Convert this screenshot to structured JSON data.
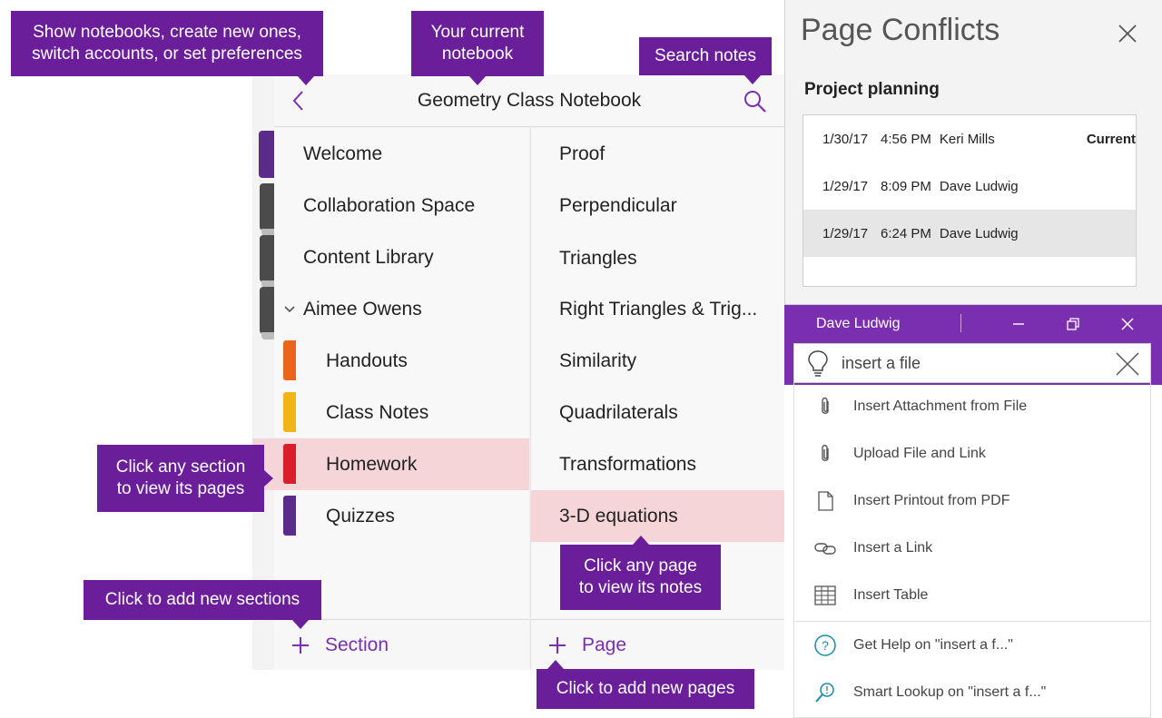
{
  "callouts": {
    "notebooks": "Show notebooks, create new ones,\nswitch accounts, or set preferences",
    "current_notebook": "Your current\nnotebook",
    "search": "Search notes",
    "section": "Click any section\nto view its pages",
    "add_sections": "Click to add new sections",
    "page": "Click any page\nto view its notes",
    "add_pages": "Click to add new pages"
  },
  "header": {
    "title": "Geometry Class Notebook",
    "back_icon": "chevron-left-icon",
    "search_icon": "search-icon"
  },
  "sections": [
    {
      "label": "Welcome",
      "level": 0
    },
    {
      "label": "Collaboration Space",
      "level": 0
    },
    {
      "label": "Content Library",
      "level": 0
    },
    {
      "label": "Aimee Owens",
      "level": 0,
      "expanded": true
    },
    {
      "label": "Handouts",
      "level": 1,
      "color": "#e8651a"
    },
    {
      "label": "Class Notes",
      "level": 1,
      "color": "#f2b418"
    },
    {
      "label": "Homework",
      "level": 1,
      "color": "#d91e2a",
      "selected": true
    },
    {
      "label": "Quizzes",
      "level": 1,
      "color": "#5b2b8c"
    }
  ],
  "pages": [
    {
      "label": "Proof"
    },
    {
      "label": "Perpendicular"
    },
    {
      "label": "Triangles"
    },
    {
      "label": "Right Triangles & Trig..."
    },
    {
      "label": "Similarity"
    },
    {
      "label": "Quadrilaterals"
    },
    {
      "label": "Transformations"
    },
    {
      "label": "3-D equations",
      "selected": true
    }
  ],
  "footer": {
    "add_section": "Section",
    "add_page": "Page"
  },
  "colors": {
    "accent": "#7a2fb0",
    "callout": "#6a1e9a",
    "selected_row": "#f6d5d9",
    "conflict_selected": "#e6e6e6"
  },
  "conflicts": {
    "title": "Page Conflicts",
    "page_name": "Project planning",
    "versions": [
      {
        "date": "1/30/17",
        "time": "4:56 PM",
        "author": "Keri Mills",
        "badge": "Current"
      },
      {
        "date": "1/29/17",
        "time": "8:09 PM",
        "author": "Dave Ludwig"
      },
      {
        "date": "1/29/17",
        "time": "6:24 PM",
        "author": "Dave Ludwig",
        "selected": true
      }
    ]
  },
  "insert_panel": {
    "user": "Dave Ludwig",
    "search_value": "insert a file",
    "items": [
      {
        "label": "Insert Attachment from File",
        "icon": "paperclip-icon"
      },
      {
        "label": "Upload File and Link",
        "icon": "paperclip-icon"
      },
      {
        "label": "Insert Printout from PDF",
        "icon": "document-icon"
      },
      {
        "label": "Insert a Link",
        "icon": "link-icon"
      },
      {
        "label": "Insert Table",
        "icon": "table-icon"
      }
    ],
    "help_items": [
      {
        "label": "Get Help on \"insert a f...\"",
        "icon": "help-icon"
      },
      {
        "label": "Smart Lookup on \"insert a f...\"",
        "icon": "smart-lookup-icon"
      }
    ]
  }
}
